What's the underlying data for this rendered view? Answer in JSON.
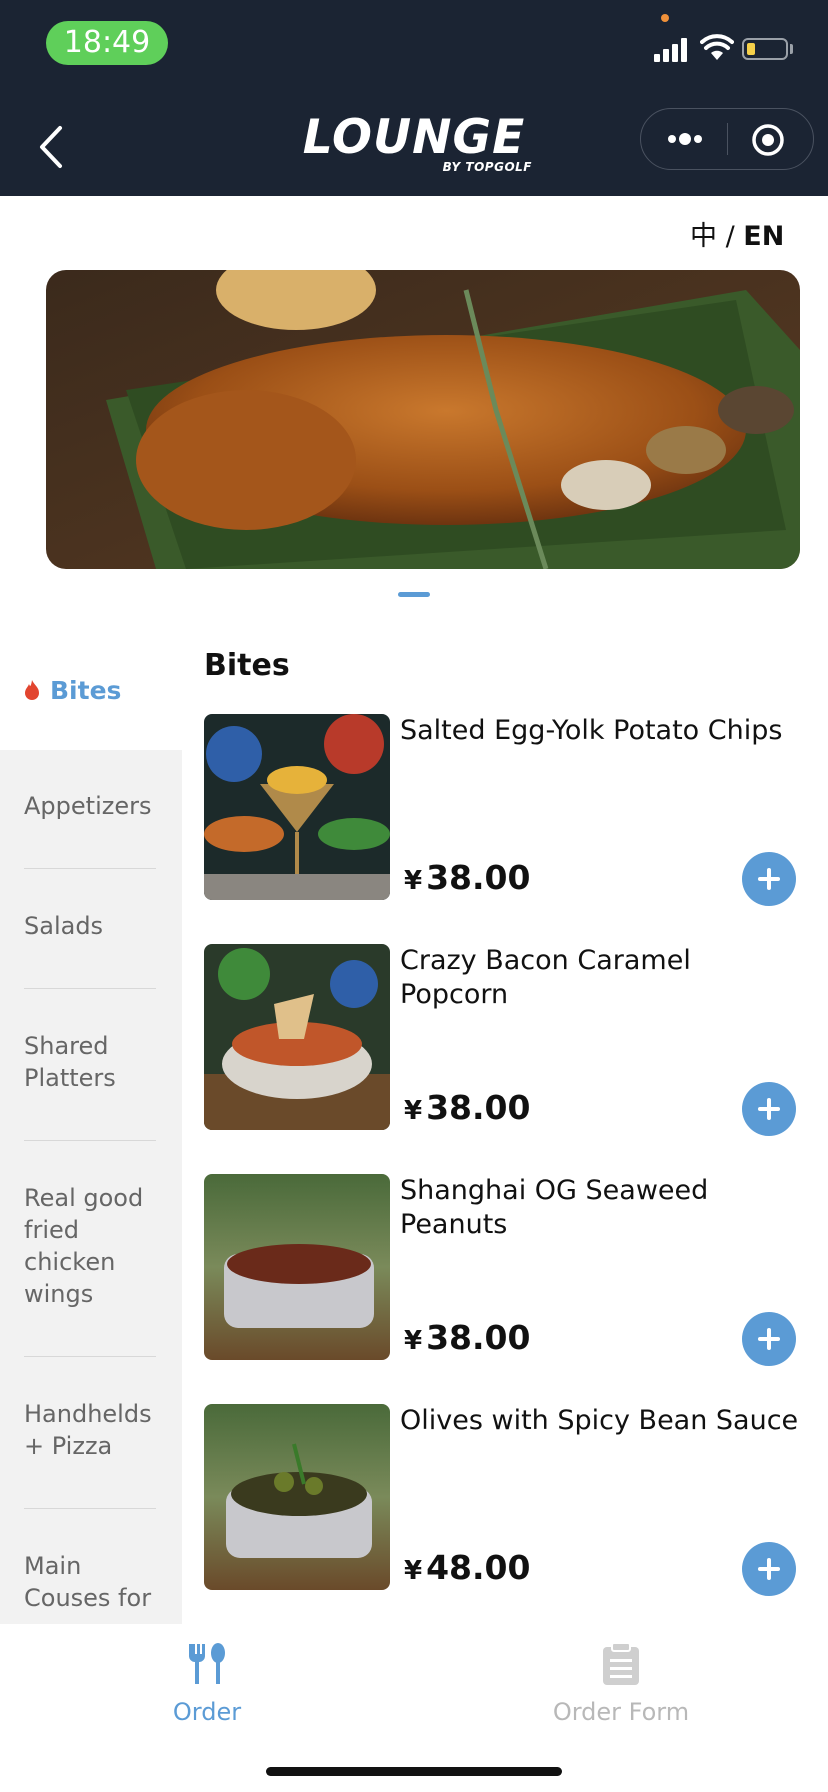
{
  "status_bar": {
    "time": "18:49"
  },
  "nav": {
    "logo_text": "LOUNGE",
    "logo_sub": "BY TOPGOLF"
  },
  "lang_switch": {
    "zh": "中",
    "sep": " / ",
    "en": "EN"
  },
  "colors": {
    "accent": "#5b9bd5",
    "header_bg": "#1b2433",
    "status_green": "#5fcf5a"
  },
  "categories": [
    {
      "label": "Bites",
      "active": true,
      "icon": "fire-icon"
    },
    {
      "label": "Appetizers"
    },
    {
      "label": "Salads"
    },
    {
      "label": "Shared Platters"
    },
    {
      "label": "Real good fried chicken wings"
    },
    {
      "label": "Handhelds + Pizza"
    },
    {
      "label": "Main Couses for"
    }
  ],
  "section": {
    "title": "Bites"
  },
  "items": [
    {
      "name": "Salted Egg-Yolk Potato Chips",
      "currency": "¥",
      "price": "38.00"
    },
    {
      "name": "Crazy Bacon Caramel Popcorn",
      "currency": "¥",
      "price": "38.00"
    },
    {
      "name": "Shanghai OG Seaweed Peanuts",
      "currency": "¥",
      "price": "38.00"
    },
    {
      "name": "Olives with Spicy Bean Sauce",
      "currency": "¥",
      "price": "48.00"
    }
  ],
  "tabbar": {
    "order": "Order",
    "order_form": "Order Form"
  }
}
